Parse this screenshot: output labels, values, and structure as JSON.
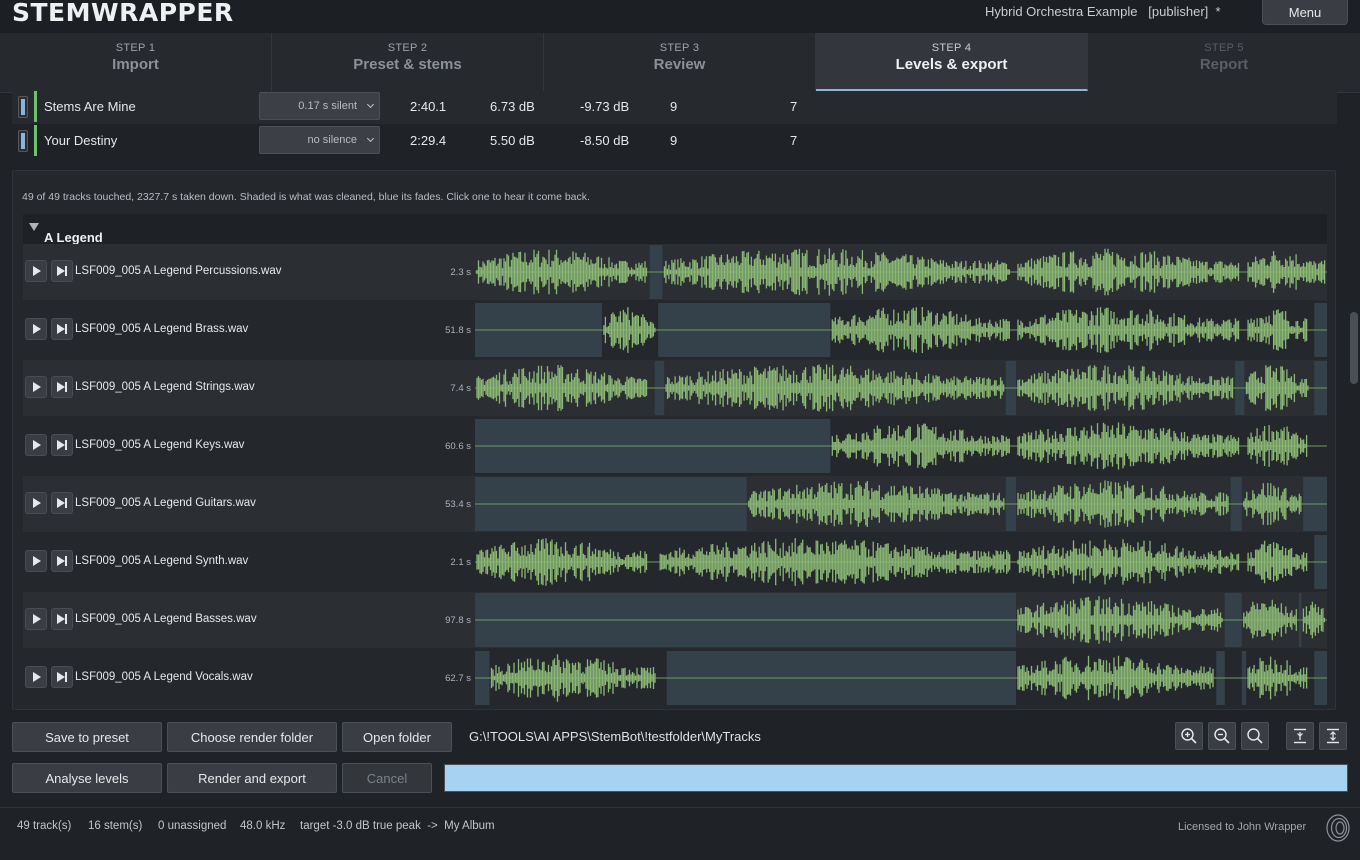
{
  "app": {
    "logo": "STEMWRAPPER",
    "project": "Hybrid Orchestra Example   [publisher]  *",
    "menu_label": "Menu"
  },
  "steps": [
    {
      "num": "STEP 1",
      "title": "Import"
    },
    {
      "num": "STEP 2",
      "title": "Preset & stems"
    },
    {
      "num": "STEP 3",
      "title": "Review"
    },
    {
      "num": "STEP 4",
      "title": "Levels & export"
    },
    {
      "num": "STEP 5",
      "title": "Report"
    }
  ],
  "active_step": 3,
  "top_tracks": [
    {
      "name": "Stems Are Mine",
      "silence": "0.17 s silent",
      "duration": "2:40.1",
      "gain": "6.73 dB",
      "peak": "-9.73 dB",
      "c1": "9",
      "c2": "7"
    },
    {
      "name": "Your Destiny",
      "silence": "no silence",
      "duration": "2:29.4",
      "gain": "5.50 dB",
      "peak": "-8.50 dB",
      "c1": "9",
      "c2": "7"
    }
  ],
  "panel": {
    "info": "49 of 49 tracks touched, 2327.7 s taken down. Shaded is what was cleaned, blue its fades. Click one to hear it come back.",
    "group_title": "A Legend",
    "tracks": [
      {
        "file": "LSF009_005 A Legend Percussions.wav",
        "removed": "2.3 s",
        "cleaned": [
          [
            0.205,
            0.22
          ]
        ],
        "active": [
          [
            0.0,
            0.205
          ],
          [
            0.22,
            0.63
          ],
          [
            0.635,
            0.9
          ],
          [
            0.905,
            1.0
          ]
        ]
      },
      {
        "file": "LSF009_005 A Legend Brass.wav",
        "removed": "51.8 s",
        "cleaned": [
          [
            0.0,
            0.149
          ],
          [
            0.215,
            0.417
          ],
          [
            0.985,
            1.0
          ]
        ],
        "active": [
          [
            0.149,
            0.215
          ],
          [
            0.417,
            0.63
          ],
          [
            0.635,
            0.9
          ],
          [
            0.905,
            0.98
          ]
        ]
      },
      {
        "file": "LSF009_005 A Legend Strings.wav",
        "removed": "7.4 s",
        "cleaned": [
          [
            0.211,
            0.222
          ],
          [
            0.623,
            0.635
          ],
          [
            0.892,
            0.903
          ],
          [
            0.985,
            1.0
          ]
        ],
        "active": [
          [
            0.0,
            0.205
          ],
          [
            0.222,
            0.623
          ],
          [
            0.635,
            0.892
          ],
          [
            0.903,
            0.98
          ]
        ]
      },
      {
        "file": "LSF009_005 A Legend Keys.wav",
        "removed": "60.6 s",
        "cleaned": [
          [
            0.0,
            0.417
          ]
        ],
        "active": [
          [
            0.417,
            0.63
          ],
          [
            0.635,
            0.9
          ],
          [
            0.905,
            0.98
          ]
        ]
      },
      {
        "file": "LSF009_005 A Legend Guitars.wav",
        "removed": "53.4 s",
        "cleaned": [
          [
            0.0,
            0.319
          ],
          [
            0.623,
            0.635
          ],
          [
            0.887,
            0.9
          ],
          [
            0.972,
            1.0
          ]
        ],
        "active": [
          [
            0.319,
            0.623
          ],
          [
            0.635,
            0.887
          ],
          [
            0.9,
            0.972
          ]
        ]
      },
      {
        "file": "LSF009_005 A Legend Synth.wav",
        "removed": "2.1 s",
        "cleaned": [
          [
            0.985,
            1.0
          ]
        ],
        "active": [
          [
            0.0,
            0.205
          ],
          [
            0.215,
            0.63
          ],
          [
            0.635,
            0.9
          ],
          [
            0.905,
            0.98
          ]
        ]
      },
      {
        "file": "LSF009_005 A Legend Basses.wav",
        "removed": "97.8 s",
        "cleaned": [
          [
            0.0,
            0.635
          ],
          [
            0.88,
            0.9
          ],
          [
            0.967,
            0.97
          ]
        ],
        "active": [
          [
            0.635,
            0.88
          ],
          [
            0.9,
            0.967
          ],
          [
            0.97,
            1.0
          ]
        ]
      },
      {
        "file": "LSF009_005 A Legend Vocals.wav",
        "removed": "62.7 s",
        "cleaned": [
          [
            0.0,
            0.017
          ],
          [
            0.225,
            0.635
          ],
          [
            0.87,
            0.88
          ],
          [
            0.9,
            0.905
          ],
          [
            0.985,
            1.0
          ]
        ],
        "active": [
          [
            0.017,
            0.215
          ],
          [
            0.635,
            0.87
          ],
          [
            0.905,
            0.98
          ]
        ]
      }
    ]
  },
  "buttons": {
    "save_preset": "Save to preset",
    "choose_folder": "Choose render folder",
    "open_folder": "Open folder",
    "analyse": "Analyse levels",
    "render": "Render and export",
    "cancel": "Cancel"
  },
  "render_path": "G:\\!TOOLS\\AI APPS\\StemBot\\!testfolder\\MyTracks",
  "progress": 1.0,
  "status": {
    "tracks": "49 track(s)",
    "stems": "16 stem(s)",
    "unassigned": "0 unassigned",
    "rate": "48.0 kHz",
    "target": "target -3.0 dB true peak  ->  My Album",
    "license": "Licensed to John Wrapper"
  },
  "colors": {
    "accent": "#8ab4d8",
    "wave": "#8bb775",
    "cleaned": "#34404a",
    "progress": "#a7d2f2"
  }
}
